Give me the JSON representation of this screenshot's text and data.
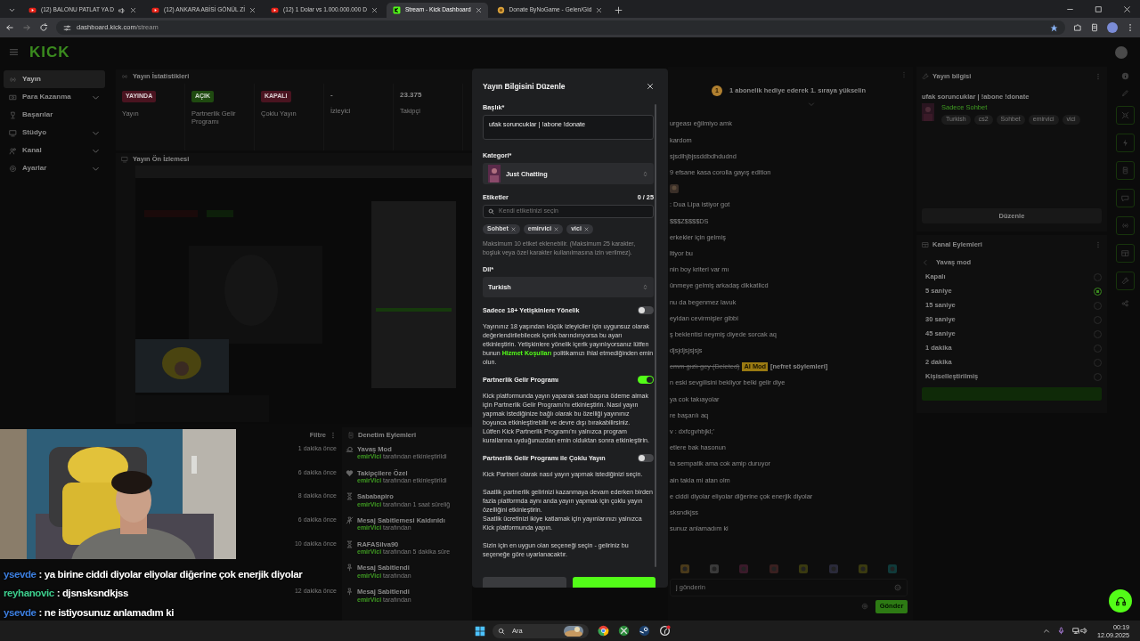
{
  "browser": {
    "tabs": [
      {
        "title": "(12) BALONU PATLAT YA D",
        "selected": false
      },
      {
        "title": "(12) ANKARA ABİSİ GÖNÜL Zİ",
        "selected": false
      },
      {
        "title": "(12) 1 Dolar vs 1.000.000.000 D",
        "selected": false
      },
      {
        "title": "Stream - Kick Dashboard",
        "selected": true
      },
      {
        "title": "Donate ByNoGame - Gelen/Gid",
        "selected": false
      }
    ],
    "url_host": "dashboard.kick.com",
    "url_path": "/stream"
  },
  "header": {
    "logo": "KICK"
  },
  "sidebar": {
    "items": [
      {
        "label": "Yayın",
        "selected": true,
        "expandable": false
      },
      {
        "label": "Para Kazanma",
        "selected": false,
        "expandable": true
      },
      {
        "label": "Başarılar",
        "selected": false,
        "expandable": false
      },
      {
        "label": "Stüdyo",
        "selected": false,
        "expandable": true
      },
      {
        "label": "Kanal",
        "selected": false,
        "expandable": true
      },
      {
        "label": "Ayarlar",
        "selected": false,
        "expandable": true
      }
    ]
  },
  "stats": {
    "title": "Yayın İstatistikleri",
    "cards": [
      {
        "kind": "badge",
        "badge": "YAYINDA",
        "color": "#4a1420",
        "label": "Yayın"
      },
      {
        "kind": "badge",
        "badge": "AÇIK",
        "color": "#1f4a10",
        "label": "Partnerlik Gelir Programı"
      },
      {
        "kind": "badge",
        "badge": "KAPALI",
        "color": "#4a1420",
        "label": "Çoklu Yayın"
      },
      {
        "kind": "value",
        "value": "-",
        "label": "İzleyici"
      },
      {
        "kind": "value",
        "value": "23.375",
        "label": "Takipçi"
      }
    ]
  },
  "preview": {
    "title": "Yayın Ön İzlemesi"
  },
  "events": {
    "filter": "Filtre"
  },
  "moderation": {
    "title": "Denetim Eylemleri",
    "rows": [
      {
        "time": "1 dakika önce",
        "action": "Yavaş Mod",
        "actor": "emirVici",
        "detail": "tarafından etkinleştirildi"
      },
      {
        "time": "6 dakika önce",
        "action": "Takipçilere Özel",
        "actor": "emirVici",
        "detail": "tarafından etkinleştirildi"
      },
      {
        "time": "8 dakika önce",
        "action": "Sababapiro",
        "actor": "emirVici",
        "detail": "tarafından 1 saat süreliğ"
      },
      {
        "time": "6 dakika önce",
        "action": "Mesaj Sabitlemesi Kaldırıldı",
        "actor": "emirVici",
        "detail": "tarafından"
      },
      {
        "time": "10 dakika önce",
        "action": "RAFASilva90",
        "actor": "emirVici",
        "detail": "tarafından 5 dakika süre"
      },
      {
        "action": "Mesaj Sabitlendi",
        "actor": "emirVici",
        "detail": "tarafından"
      },
      {
        "time": "12 dakika önce",
        "action": "Mesaj Sabitlendi",
        "actor": "emirVici",
        "detail": "tarafından"
      }
    ]
  },
  "modal": {
    "title": "Yayın Bilgisini Düzenle",
    "title_label": "Başlık*",
    "title_value": "ufak soruncuklar | !abone !donate",
    "category_label": "Kategori*",
    "category": "Just Chatting",
    "tags_label": "Etiketler",
    "tags_count": "0 / 25",
    "tags_placeholder": "Kendi etiketinizi seçin",
    "tags": [
      "Sohbet",
      "emirvici",
      "vici"
    ],
    "tags_help": "Maksimum 10 etiket eklenebilir. (Maksimum 25 karakter, boşluk veya özel karakter kullanılmasına izin verilmez).",
    "language_label": "Dil*",
    "language": "Turkish",
    "toggles": [
      {
        "label": "Sadece 18+ Yetişkinlere Yönelik",
        "on": false,
        "paragraphs": [
          [
            {
              "before": "Yayınınız 18 yaşından küçük izleyiciler için uygunsuz olarak değerlendirilebilecek içerik barındırıyorsa bu ayarı etkinleştirin. Yetişkinlere yönelik içerik yayınlıyorsanız lütfen bunun",
              "link": "Hizmet Koşulları",
              "after": "politikamızı ihlal etmediğinden emin olun."
            }
          ]
        ]
      },
      {
        "label": "Partnerlik Gelir Programı",
        "on": true,
        "paragraphs": [
          [
            "Kick platformunda yayın yaparak saat başına ödeme almak için Partnerlik Gelir Programı'nı etkinleştirin. Nasıl yayın yapmak istediğinize bağlı olarak bu özelliği yayınınız boyunca etkinleştirebilir ve devre dışı bırakabilirsiniz.",
            "Lütfen Kick Partnerlik Programı'nı yalnızca program kurallarına uyduğunuzdan emin olduktan sonra etkinleştirin."
          ]
        ]
      },
      {
        "label": "Partnerlik Gelir Programı ile Çoklu Yayın",
        "on": false,
        "paragraphs": [
          [
            "Kick Partneri olarak nasıl yayın yapmak istediğinizi seçin."
          ],
          [
            "Saatlik partnerlik gelirinizi kazanmaya devam ederken birden fazla platformda aynı anda yayın yapmak için çoklu yayın özelliğini etkinleştirin.",
            "Saatlik ücretinizi ikiye katlamak için yayınlarınızı yalnızca Kick platformunda yapın."
          ],
          [
            "Sizin için en uygun olan seçeneği seçin - geliriniz bu seçeneğe göre uyarlanacaktır."
          ]
        ]
      }
    ]
  },
  "chat": {
    "promo_rank": "1",
    "promo": "1 abonelik hediye ederek 1. sıraya yükselin",
    "lines": [
      {
        "kind": "message",
        "text": "urgeası eğilmiyo amk"
      },
      {
        "kind": "message",
        "text": "kardom"
      },
      {
        "kind": "message",
        "text": "sjsdlhjbjssddbdhdudnd"
      },
      {
        "kind": "message",
        "text": "9 efsane kasa corolla gayış edition"
      },
      {
        "kind": "emote"
      },
      {
        "kind": "message",
        "text": ": Dua Lipa istiyor got"
      },
      {
        "kind": "message",
        "text": "$$$Z$$$$DS"
      },
      {
        "kind": "message",
        "text": "erkekler için gelmiş"
      },
      {
        "kind": "message",
        "text": "ltiyor bu"
      },
      {
        "kind": "message",
        "text": "nin boy kriteri var mı"
      },
      {
        "kind": "message",
        "text": "ünmeye gelmiş arkadaş dikkatlicd"
      },
      {
        "kind": "message",
        "text": "nu da begenmez lavuk"
      },
      {
        "kind": "message",
        "text": "eyldan cevirmişler gibbi"
      },
      {
        "kind": "message",
        "text": "ş beklentisi neymiş diyede sorcak aq"
      },
      {
        "kind": "message",
        "text": "djsjdjsjsjsjs"
      },
      {
        "kind": "moderated",
        "text": "emm gızlı gey (Deleted)",
        "tag": "AI Mod",
        "reason": "[nefret söylemleri]"
      },
      {
        "kind": "message",
        "text": "n eski sevgilisini bekliyor belki gelir diye"
      },
      {
        "kind": "message",
        "text": "ya cok takıayolar"
      },
      {
        "kind": "message",
        "text": "re başarılı aq"
      },
      {
        "kind": "message",
        "text": "v : dxfcgvhbjkl;'"
      },
      {
        "kind": "message",
        "text": "etlere bak hasonun"
      },
      {
        "kind": "message",
        "text": "ta sempatik ama cok amip duruyor"
      },
      {
        "kind": "message",
        "text": "ain takla mi atan olm"
      },
      {
        "kind": "message",
        "text": "e ciddi diyolar eliyolar diğerine çok enerjik diyolar"
      },
      {
        "kind": "message",
        "text": "sksndkjss"
      },
      {
        "kind": "message",
        "text": "sunuz anlamadım ki"
      }
    ],
    "input_placeholder": "j gönderin",
    "send": "Gönder"
  },
  "stream_info": {
    "title": "Yayın bilgisi",
    "stream_title": "ufak soruncuklar | !abone !donate",
    "category": "Sadece Sohbet",
    "tags": [
      "Turkish",
      "cs2",
      "Sohbet",
      "emirvici",
      "vici"
    ],
    "edit": "Düzenle"
  },
  "channel_actions": {
    "title": "Kanal Eylemleri",
    "back": "Yavaş mod",
    "options": [
      {
        "label": "Kapalı",
        "selected": false
      },
      {
        "label": "5 saniye",
        "selected": true
      },
      {
        "label": "15 saniye",
        "selected": false
      },
      {
        "label": "30 saniye",
        "selected": false
      },
      {
        "label": "45 saniye",
        "selected": false
      },
      {
        "label": "1 dakika",
        "selected": false
      },
      {
        "label": "2 dakika",
        "selected": false
      },
      {
        "label": "Kişiselleştirilmiş",
        "selected": false
      }
    ]
  },
  "overlay_chat": [
    {
      "user": "ysevde",
      "color": "#3d7fe0",
      "text": ": ya birine ciddi diyolar eliyolar diğerine çok enerjik diyolar"
    },
    {
      "user": "reyhanovic",
      "color": "#3ecf8e",
      "text": ": djsnsksndkjss"
    },
    {
      "user": "ysevde",
      "color": "#3d7fe0",
      "text": ": ne istiyosunuz anlamadım ki"
    }
  ],
  "taskbar": {
    "search": "Ara",
    "time": "00:19",
    "date": "12.09.2025"
  }
}
